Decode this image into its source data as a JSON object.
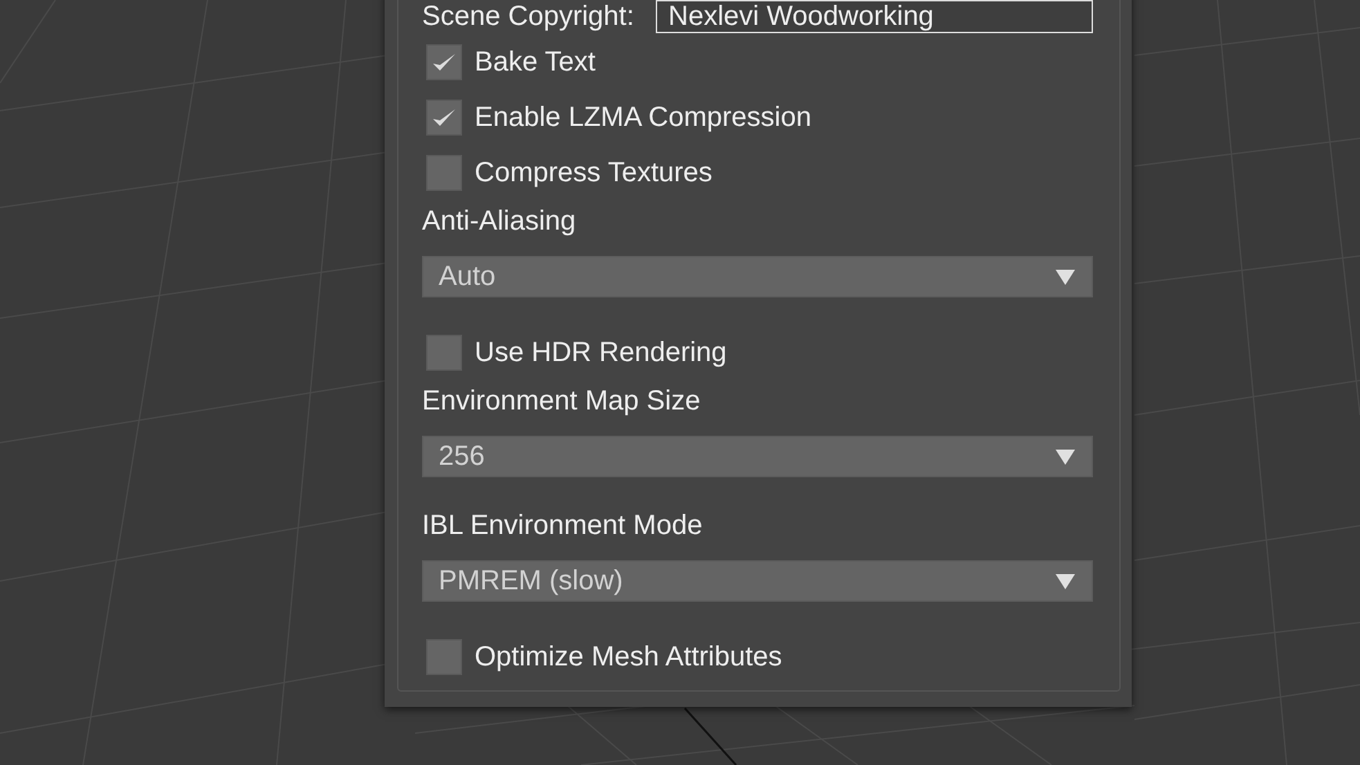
{
  "copyright": {
    "label": "Scene Copyright:",
    "value": "Nexlevi Woodworking"
  },
  "options": [
    {
      "kind": "checkbox",
      "label": "Bake Text",
      "checked": true
    },
    {
      "kind": "checkbox",
      "label": "Enable LZMA Compression",
      "checked": true
    },
    {
      "kind": "checkbox",
      "label": "Compress Textures",
      "checked": false
    },
    {
      "kind": "dropdown",
      "label": "Anti-Aliasing",
      "value": "Auto"
    },
    {
      "kind": "checkbox",
      "label": "Use HDR Rendering",
      "checked": false
    },
    {
      "kind": "dropdown",
      "label": "Environment Map Size",
      "value": "256"
    },
    {
      "kind": "dropdown",
      "label": "IBL Environment Mode",
      "value": "PMREM (slow)"
    },
    {
      "kind": "checkbox",
      "label": "Optimize Mesh Attributes",
      "checked": false
    }
  ]
}
